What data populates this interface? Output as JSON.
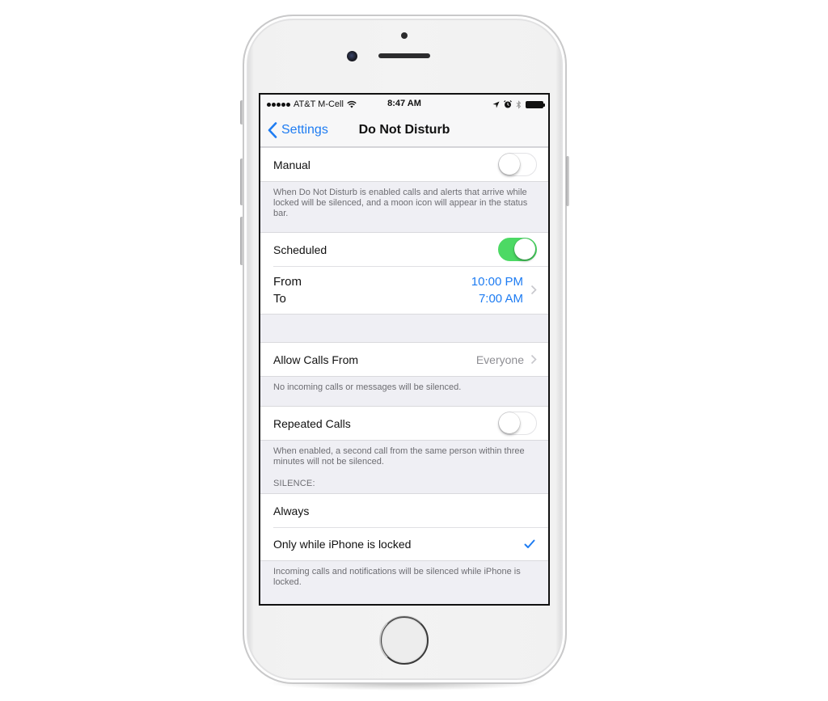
{
  "status_bar": {
    "signal_dots": 5,
    "carrier": "AT&T M-Cell",
    "time": "8:47 AM",
    "icons": [
      "wifi-icon",
      "location-arrow-icon",
      "alarm-icon",
      "bluetooth-icon",
      "battery-icon"
    ],
    "battery_level": 1.0
  },
  "nav": {
    "back_label": "Settings",
    "title": "Do Not Disturb"
  },
  "manual": {
    "label": "Manual",
    "enabled": false,
    "note": "When Do Not Disturb is enabled calls and alerts that arrive while locked will be silenced, and a moon icon will appear in the status bar."
  },
  "scheduled": {
    "label": "Scheduled",
    "enabled": true,
    "from_label": "From",
    "to_label": "To",
    "from_value": "10:00 PM",
    "to_value": "7:00 AM"
  },
  "allow_calls": {
    "label": "Allow Calls From",
    "value": "Everyone",
    "note": "No incoming calls or messages will be silenced."
  },
  "repeated_calls": {
    "label": "Repeated Calls",
    "enabled": false,
    "note": "When enabled, a second call from the same person within three minutes will not be silenced."
  },
  "silence": {
    "header": "SILENCE:",
    "options": [
      {
        "label": "Always",
        "selected": false
      },
      {
        "label": "Only while iPhone is locked",
        "selected": true
      }
    ],
    "note": "Incoming calls and notifications will be silenced while iPhone is locked."
  },
  "colors": {
    "accent": "#1e7cf2",
    "switch_on": "#4cd964",
    "secondary_text": "#8e8e93",
    "group_background": "#efeff4"
  }
}
